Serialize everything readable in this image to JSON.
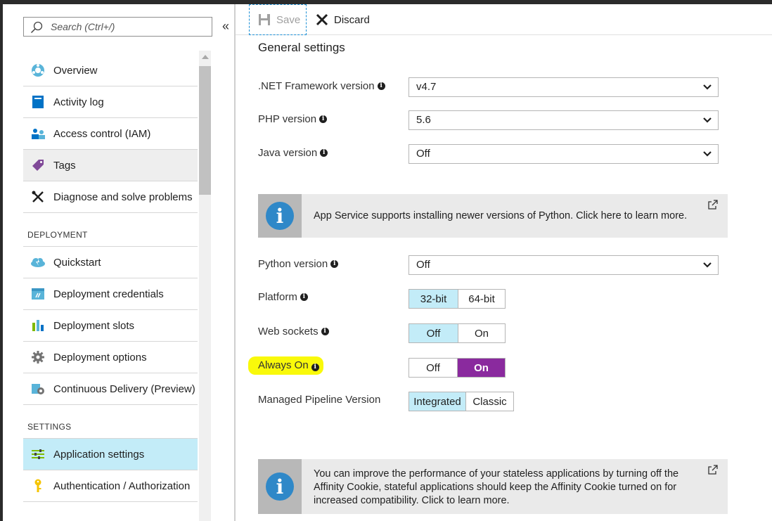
{
  "search": {
    "placeholder": "Search (Ctrl+/)"
  },
  "sidebar": {
    "collapse_label": "«",
    "items_top": [
      {
        "label": "Overview",
        "icon": "overview-icon"
      },
      {
        "label": "Activity log",
        "icon": "activity-log-icon"
      },
      {
        "label": "Access control (IAM)",
        "icon": "iam-icon"
      },
      {
        "label": "Tags",
        "icon": "tag-icon"
      },
      {
        "label": "Diagnose and solve problems",
        "icon": "diagnose-icon"
      }
    ],
    "section_deployment": "DEPLOYMENT",
    "items_deployment": [
      {
        "label": "Quickstart",
        "icon": "quickstart-icon"
      },
      {
        "label": "Deployment credentials",
        "icon": "credentials-icon"
      },
      {
        "label": "Deployment slots",
        "icon": "slots-icon"
      },
      {
        "label": "Deployment options",
        "icon": "gear-icon"
      },
      {
        "label": "Continuous Delivery (Preview)",
        "icon": "continuous-delivery-icon"
      }
    ],
    "section_settings": "SETTINGS",
    "items_settings": [
      {
        "label": "Application settings",
        "icon": "app-settings-icon"
      },
      {
        "label": "Authentication / Authorization",
        "icon": "key-icon"
      }
    ]
  },
  "toolbar": {
    "save_label": "Save",
    "discard_label": "Discard"
  },
  "general": {
    "title": "General settings",
    "net_label": ".NET Framework version",
    "net_value": "v4.7",
    "php_label": "PHP version",
    "php_value": "5.6",
    "java_label": "Java version",
    "java_value": "Off",
    "python_notice": "App Service supports installing newer versions of Python. Click here to learn more.",
    "python_label": "Python version",
    "python_value": "Off",
    "platform_label": "Platform",
    "platform_options": [
      "32-bit",
      "64-bit"
    ],
    "websockets_label": "Web sockets",
    "websockets_options": [
      "Off",
      "On"
    ],
    "alwayson_label": "Always On",
    "alwayson_options": [
      "Off",
      "On"
    ],
    "pipeline_label": "Managed Pipeline Version",
    "pipeline_options": [
      "Integrated",
      "Classic"
    ],
    "affinity_notice": "You can improve the performance of your stateless applications by turning off the Affinity Cookie, stateful applications should keep the Affinity Cookie turned on for increased compatibility. Click to learn more."
  },
  "colors": {
    "selected": "#c3ecf8",
    "on_purple": "#8a2a9e",
    "highlight": "#f9f90a",
    "info_blue": "#2f88c8"
  }
}
